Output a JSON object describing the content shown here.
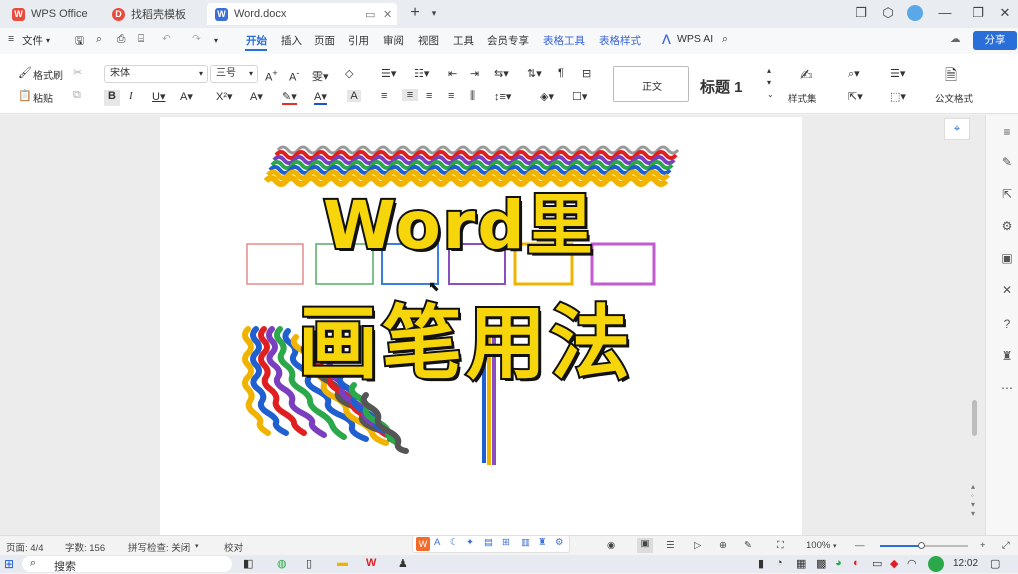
{
  "tabs": [
    {
      "label": "WPS Office",
      "color": "#e84c3d"
    },
    {
      "label": "找稻壳模板",
      "color": "#e84c3d"
    },
    {
      "label": "Word.docx",
      "color": "#3b6fd8"
    }
  ],
  "menu": {
    "file": "文件",
    "items": [
      "开始",
      "插入",
      "页面",
      "引用",
      "审阅",
      "视图",
      "工具",
      "会员专享",
      "表格工具",
      "表格样式"
    ],
    "ai": "WPS AI",
    "share": "分享"
  },
  "ribbon": {
    "format_painter": "格式刷",
    "paste": "粘贴",
    "font_name": "宋体",
    "font_size": "三号",
    "style_normal": "正文",
    "style_heading": "标题 1",
    "style_set": "样式集",
    "official_doc": "公文格式"
  },
  "overlay": {
    "line1": "Word里",
    "line2": "画笔用法"
  },
  "status": {
    "page": "页面: 4/4",
    "words": "字数: 156",
    "spell": "拼写检查: 关闭",
    "proof": "校对",
    "zoom": "100%"
  },
  "taskbar": {
    "search": "搜索",
    "time": "12:02"
  },
  "colors": {
    "accent": "#2a6ed8",
    "title_fill": "#f6d60a",
    "title_stroke": "#111111"
  }
}
